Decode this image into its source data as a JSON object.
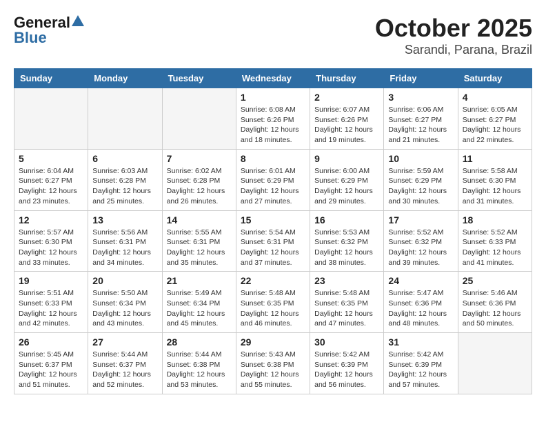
{
  "header": {
    "logo_general": "General",
    "logo_blue": "Blue",
    "title": "October 2025",
    "subtitle": "Sarandi, Parana, Brazil"
  },
  "calendar": {
    "days_of_week": [
      "Sunday",
      "Monday",
      "Tuesday",
      "Wednesday",
      "Thursday",
      "Friday",
      "Saturday"
    ],
    "weeks": [
      [
        {
          "day": "",
          "info": ""
        },
        {
          "day": "",
          "info": ""
        },
        {
          "day": "",
          "info": ""
        },
        {
          "day": "1",
          "info": "Sunrise: 6:08 AM\nSunset: 6:26 PM\nDaylight: 12 hours\nand 18 minutes."
        },
        {
          "day": "2",
          "info": "Sunrise: 6:07 AM\nSunset: 6:26 PM\nDaylight: 12 hours\nand 19 minutes."
        },
        {
          "day": "3",
          "info": "Sunrise: 6:06 AM\nSunset: 6:27 PM\nDaylight: 12 hours\nand 21 minutes."
        },
        {
          "day": "4",
          "info": "Sunrise: 6:05 AM\nSunset: 6:27 PM\nDaylight: 12 hours\nand 22 minutes."
        }
      ],
      [
        {
          "day": "5",
          "info": "Sunrise: 6:04 AM\nSunset: 6:27 PM\nDaylight: 12 hours\nand 23 minutes."
        },
        {
          "day": "6",
          "info": "Sunrise: 6:03 AM\nSunset: 6:28 PM\nDaylight: 12 hours\nand 25 minutes."
        },
        {
          "day": "7",
          "info": "Sunrise: 6:02 AM\nSunset: 6:28 PM\nDaylight: 12 hours\nand 26 minutes."
        },
        {
          "day": "8",
          "info": "Sunrise: 6:01 AM\nSunset: 6:29 PM\nDaylight: 12 hours\nand 27 minutes."
        },
        {
          "day": "9",
          "info": "Sunrise: 6:00 AM\nSunset: 6:29 PM\nDaylight: 12 hours\nand 29 minutes."
        },
        {
          "day": "10",
          "info": "Sunrise: 5:59 AM\nSunset: 6:29 PM\nDaylight: 12 hours\nand 30 minutes."
        },
        {
          "day": "11",
          "info": "Sunrise: 5:58 AM\nSunset: 6:30 PM\nDaylight: 12 hours\nand 31 minutes."
        }
      ],
      [
        {
          "day": "12",
          "info": "Sunrise: 5:57 AM\nSunset: 6:30 PM\nDaylight: 12 hours\nand 33 minutes."
        },
        {
          "day": "13",
          "info": "Sunrise: 5:56 AM\nSunset: 6:31 PM\nDaylight: 12 hours\nand 34 minutes."
        },
        {
          "day": "14",
          "info": "Sunrise: 5:55 AM\nSunset: 6:31 PM\nDaylight: 12 hours\nand 35 minutes."
        },
        {
          "day": "15",
          "info": "Sunrise: 5:54 AM\nSunset: 6:31 PM\nDaylight: 12 hours\nand 37 minutes."
        },
        {
          "day": "16",
          "info": "Sunrise: 5:53 AM\nSunset: 6:32 PM\nDaylight: 12 hours\nand 38 minutes."
        },
        {
          "day": "17",
          "info": "Sunrise: 5:52 AM\nSunset: 6:32 PM\nDaylight: 12 hours\nand 39 minutes."
        },
        {
          "day": "18",
          "info": "Sunrise: 5:52 AM\nSunset: 6:33 PM\nDaylight: 12 hours\nand 41 minutes."
        }
      ],
      [
        {
          "day": "19",
          "info": "Sunrise: 5:51 AM\nSunset: 6:33 PM\nDaylight: 12 hours\nand 42 minutes."
        },
        {
          "day": "20",
          "info": "Sunrise: 5:50 AM\nSunset: 6:34 PM\nDaylight: 12 hours\nand 43 minutes."
        },
        {
          "day": "21",
          "info": "Sunrise: 5:49 AM\nSunset: 6:34 PM\nDaylight: 12 hours\nand 45 minutes."
        },
        {
          "day": "22",
          "info": "Sunrise: 5:48 AM\nSunset: 6:35 PM\nDaylight: 12 hours\nand 46 minutes."
        },
        {
          "day": "23",
          "info": "Sunrise: 5:48 AM\nSunset: 6:35 PM\nDaylight: 12 hours\nand 47 minutes."
        },
        {
          "day": "24",
          "info": "Sunrise: 5:47 AM\nSunset: 6:36 PM\nDaylight: 12 hours\nand 48 minutes."
        },
        {
          "day": "25",
          "info": "Sunrise: 5:46 AM\nSunset: 6:36 PM\nDaylight: 12 hours\nand 50 minutes."
        }
      ],
      [
        {
          "day": "26",
          "info": "Sunrise: 5:45 AM\nSunset: 6:37 PM\nDaylight: 12 hours\nand 51 minutes."
        },
        {
          "day": "27",
          "info": "Sunrise: 5:44 AM\nSunset: 6:37 PM\nDaylight: 12 hours\nand 52 minutes."
        },
        {
          "day": "28",
          "info": "Sunrise: 5:44 AM\nSunset: 6:38 PM\nDaylight: 12 hours\nand 53 minutes."
        },
        {
          "day": "29",
          "info": "Sunrise: 5:43 AM\nSunset: 6:38 PM\nDaylight: 12 hours\nand 55 minutes."
        },
        {
          "day": "30",
          "info": "Sunrise: 5:42 AM\nSunset: 6:39 PM\nDaylight: 12 hours\nand 56 minutes."
        },
        {
          "day": "31",
          "info": "Sunrise: 5:42 AM\nSunset: 6:39 PM\nDaylight: 12 hours\nand 57 minutes."
        },
        {
          "day": "",
          "info": ""
        }
      ]
    ]
  }
}
